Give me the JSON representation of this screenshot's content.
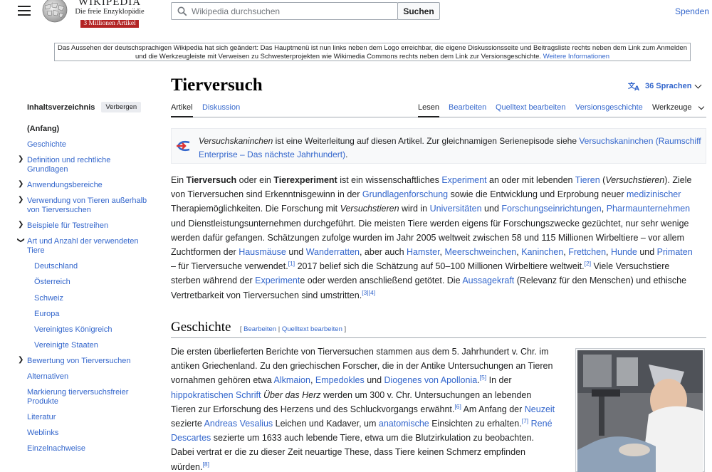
{
  "header": {
    "logo_title": "WIKIPEDIA",
    "logo_tagline": "Die freie Enzyklopädie",
    "logo_badge": "3 Millionen Artikel",
    "search_placeholder": "Wikipedia durchsuchen",
    "search_button": "Suchen",
    "donate": "Spenden"
  },
  "notice": {
    "text": "Das Aussehen der deutschsprachigen Wikipedia hat sich geändert: Das Hauptmenü ist nun links neben dem Logo erreichbar, die eigene Diskussionsseite und Beitragsliste rechts neben dem Link zum Anmelden und die Werkzeugleiste mit Verweisen zu Schwesterprojekten wie Wikimedia Commons rechts neben dem Link zur Versionsgeschichte.",
    "link": "Weitere Informationen"
  },
  "toc": {
    "title": "Inhaltsverzeichnis",
    "hide_button": "Verbergen",
    "items": [
      {
        "label": "(Anfang)"
      },
      {
        "label": "Geschichte"
      },
      {
        "label": "Definition und rechtliche Grundlagen"
      },
      {
        "label": "Anwendungsbereiche"
      },
      {
        "label": "Verwendung von Tieren außerhalb von Tierversuchen"
      },
      {
        "label": "Beispiele für Testreihen"
      },
      {
        "label": "Art und Anzahl der verwendeten Tiere"
      },
      {
        "label": "Deutschland"
      },
      {
        "label": "Österreich"
      },
      {
        "label": "Schweiz"
      },
      {
        "label": "Europa"
      },
      {
        "label": "Vereinigtes Königreich"
      },
      {
        "label": "Vereinigte Staaten"
      },
      {
        "label": "Bewertung von Tierversuchen"
      },
      {
        "label": "Alternativen"
      },
      {
        "label": "Markierung tierversuchsfreier Produkte"
      },
      {
        "label": "Literatur"
      },
      {
        "label": "Weblinks"
      },
      {
        "label": "Einzelnachweise"
      }
    ]
  },
  "article": {
    "title": "Tierversuch",
    "languages": "36 Sprachen",
    "tabs": {
      "article": "Artikel",
      "discussion": "Diskussion",
      "read": "Lesen",
      "edit": "Bearbeiten",
      "edit_source": "Quelltext bearbeiten",
      "history": "Versionsgeschichte",
      "tools": "Werkzeuge"
    },
    "hatnote": {
      "italic": "Versuchskaninchen",
      "text": " ist eine Weiterleitung auf diesen Artikel. Zur gleichnamigen Serienepisode siehe ",
      "link": "Versuchskaninchen (Raumschiff Enterprise – Das nächste Jahrhundert)",
      "end": "."
    },
    "intro_lines": [
      "Ein Tierversuch oder ein Tierexperiment ist ein wissenschaftliches Experiment an oder mit lebenden Tieren (Versuchstieren). Ziele",
      "von Tierversuchen sind Erkenntnisgewinn in der Grundlagenforschung sowie die Entwicklung und Erprobung neuer medizinischer",
      "Therapiemöglichkeiten. Die Forschung mit Versuchstieren wird in Universitäten und Forschungseinrichtungen, Pharmaunternehmen",
      "und Dienstleistungsunternehmen durchgeführt. Die meisten Tiere werden eigens für Forschungszwecke gezüchtet, nur sehr wenige",
      "werden dafür gefangen. Schätzungen zufolge wurden im Jahr 2005 weltweit zwischen 58 und 115 Millionen Wirbeltiere – vor allem",
      "Zuchtformen der Hausmäuse und Wanderratten, aber auch Hamster, Meerschweinchen, Kaninchen, Frettchen, Hunde und Primaten",
      "– für Tierversuche verwendet.[1] 2017 belief sich die Schätzung auf 50–100 Millionen Wirbeltiere weltweit.[2] Viele Versuchstiere",
      "sterben während der Experimente oder werden anschließend getötet. Die Aussagekraft (Relevanz für den Menschen) und ethische",
      "Vertretbarkeit von Tierversuchen sind umstritten.[3][4]"
    ],
    "section": {
      "title": "Geschichte",
      "edit": "Bearbeiten",
      "edit_source": "Quelltext bearbeiten"
    },
    "history_lines": [
      "Die ersten überlieferten Berichte von Tierversuchen stammen aus dem 5. Jahrhundert v. Chr. im",
      "antiken Griechenland. Zu den griechischen Forscher, die in der Antike Untersuchungen an Tieren",
      "vornahmen gehören etwa Alkmaion, Empedokles und Diogenes von Apollonia.[5] In der",
      "hippokratischen Schrift Über das Herz werden um 300 v. Chr. Untersuchungen an lebenden",
      "Tieren zur Erforschung des Herzens und des Schluckvorgangs erwähnt.[6] Am Anfang der Neuzeit",
      "sezierte Andreas Vesalius Leichen und Kadaver, um anatomische Einsichten zu erhalten.[7] René",
      "Descartes sezierte um 1633 auch lebende Tiere, etwa um die Blutzirkulation zu beobachten.",
      "Dabei vertrat er die zu dieser Zeit neuartige These, dass Tiere keinen Schmerz empfinden",
      "würden.[8]"
    ]
  },
  "colors": {
    "link": "#3366cc",
    "text": "#202122",
    "border": "#a2a9b1",
    "badge": "#b32424"
  }
}
